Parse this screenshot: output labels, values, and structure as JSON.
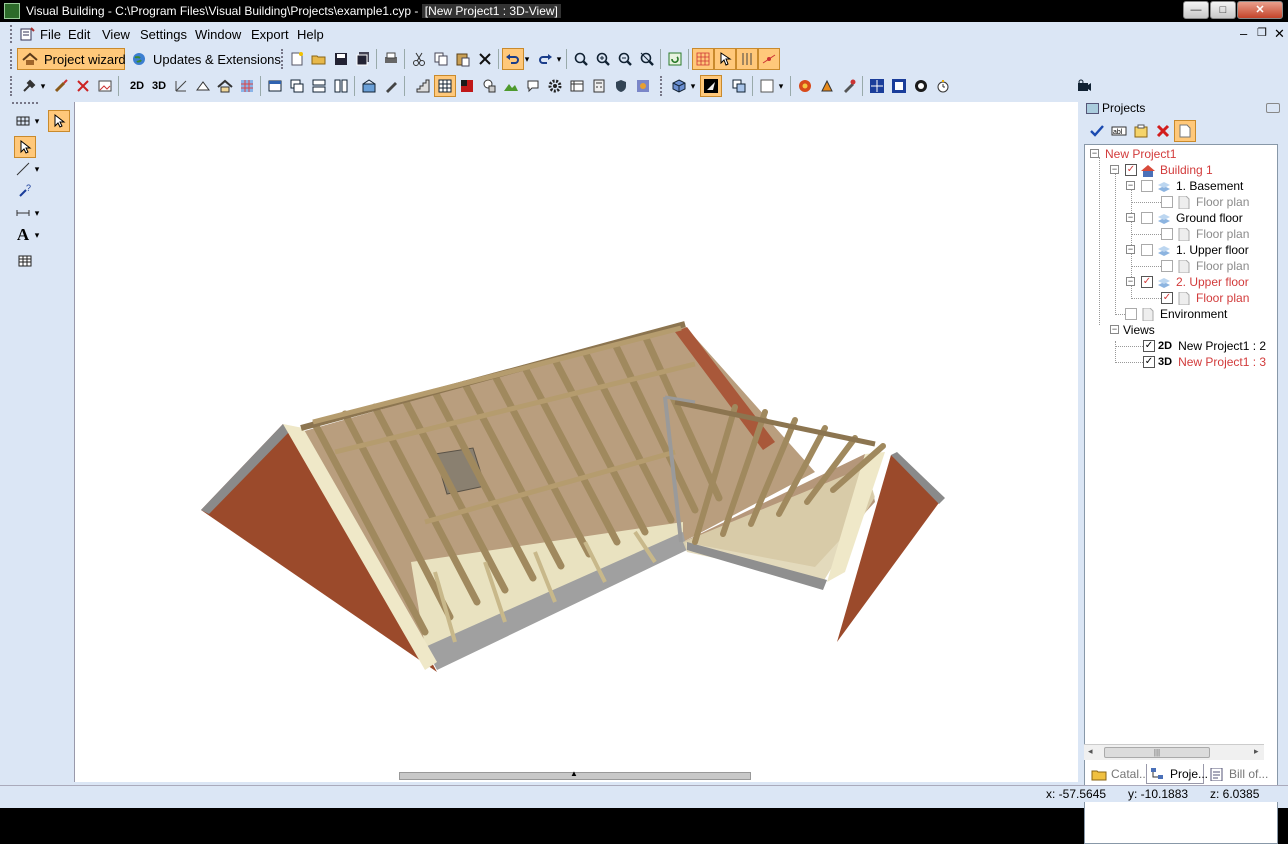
{
  "window": {
    "title": "Visual Building - C:\\Program Files\\Visual Building\\Projects\\example1.cyp - [New Project1 : 3D-View]",
    "title_main": "Visual Building - C:\\Program Files\\Visual Building\\Projects\\example1.cyp - ",
    "title_doc": "[New Project1 : 3D-View]",
    "minimize": "—",
    "maximize": "□",
    "close": "✕"
  },
  "menu": {
    "items": [
      "File",
      "Edit",
      "View",
      "Settings",
      "Window",
      "Export",
      "Help"
    ],
    "mdi_min": "–",
    "mdi_restore": "❐",
    "mdi_close": "✕"
  },
  "toolbar1": {
    "project_wizard": "Project wizard",
    "updates": "Updates & Extensions"
  },
  "toolbar2": {
    "label_2d": "2D",
    "label_3d": "3D",
    "combo_value": ""
  },
  "left_tools": {
    "text_tool": "A"
  },
  "panel": {
    "title": "Projects",
    "tree": {
      "project": "New Project1",
      "building": "Building 1",
      "floors": [
        {
          "name": "1. Basement",
          "plan": "Floor plan",
          "checked": false
        },
        {
          "name": "Ground floor",
          "plan": "Floor plan",
          "checked": false
        },
        {
          "name": "1. Upper floor",
          "plan": "Floor plan",
          "checked": false
        },
        {
          "name": "2. Upper floor",
          "plan": "Floor plan",
          "checked": true
        }
      ],
      "environment": "Environment",
      "views_label": "Views",
      "views": [
        {
          "tag": "2D",
          "name": "New Project1 : 2"
        },
        {
          "tag": "3D",
          "name": "New Project1 : 3"
        }
      ]
    },
    "tabs": [
      "Catal...",
      "Proje...",
      "Bill of..."
    ]
  },
  "status": {
    "x": "x: -57.5645",
    "y": "y: -10.1883",
    "z": "z: 6.0385"
  },
  "colors": {
    "accent": "#ffc87a",
    "chrome": "#dbe6f5",
    "active_red": "#d23b3b"
  }
}
